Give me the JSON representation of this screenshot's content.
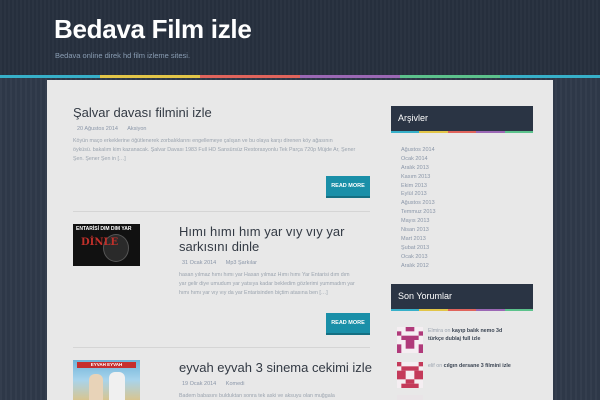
{
  "site": {
    "title": "Bedava Film izle",
    "description": "Bedava online direk hd film izleme sitesi."
  },
  "colors": {
    "accent": "#1a8fa8",
    "stripe": [
      "#37b0c9",
      "#e2c548",
      "#e0645c",
      "#9b68b5",
      "#5cc28c",
      "#37b0c9"
    ]
  },
  "posts": [
    {
      "title": "Şalvar davası filmini izle",
      "date": "20 Ağustos 2014",
      "category": "Aksiyon",
      "excerpt_line1": "Köyün maço erkeklerine öğütlenerek zorbalıklarını engellemeye çalışan ve bu olaya karşı direnen köy ağasının",
      "excerpt_line2": "öyküsü. bakalım kim kazanacak. Şalvar Davası 1983 Full HD Sansürsüz Restorasyonlu Tek Parça 720p Müjde Ar, Şener",
      "excerpt_line3": "Şen. Şener Şen in […]",
      "read_more": "READ MORE"
    },
    {
      "title_line1": "Hımı hımı hım yar vıy vıy yar",
      "title_line2": "sarkısını dinle",
      "date": "31 Ocak 2014",
      "category": "Mp3 Şarkılar",
      "thumb_text1": "ENTARİSİ DIM DIM YAR",
      "thumb_text2": "DİNLE",
      "excerpt_line1": "hasan yılmaz hımı hımı yar Hasan yılmaz Hımı hımı Yar Entarisi dım dım",
      "excerpt_line2": "yar gelir diye umudum yar yatsıya kadar bekledim gözlerimi yummadım yar",
      "excerpt_line3": "hımı hımı yar vıy vıy da yar Entarisinden biçtim atasına ben […]",
      "read_more": "READ MORE"
    },
    {
      "title": "eyvah eyvah 3 sinema cekimi izle",
      "date": "19 Ocak 2014",
      "category": "Komedi",
      "thumb_text": "EYVAH EYVAH",
      "excerpt_line1": "Badem babasını bulduktan sonra tek aski ve aksuyu olan muğgala"
    }
  ],
  "archives": {
    "heading": "Arşivler",
    "items": [
      "Ağustos 2014",
      "Ocak 2014",
      "Aralık 2013",
      "Kasım 2013",
      "Ekim 2013",
      "Eylül 2013",
      "Ağustos 2013",
      "Temmuz 2013",
      "Mayıs 2013",
      "Nisan 2013",
      "Mart 2013",
      "Şubat 2013",
      "Ocak 2013",
      "Aralık 2012"
    ]
  },
  "comments": {
    "heading": "Son Yorumlar",
    "items": [
      {
        "author": "Elmira",
        "on": "on",
        "post_line1": "kayıp balık nemo 3d",
        "post_line2": "türkçe dublaj full izle"
      },
      {
        "author": "elif",
        "on": "on",
        "post_line1": "cılgın dersane 3 filmini izle",
        "post_line2": ""
      }
    ]
  }
}
